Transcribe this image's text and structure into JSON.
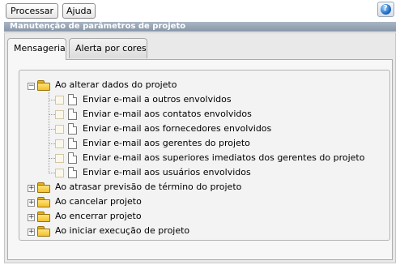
{
  "toolbar": {
    "processar_label": "Processar",
    "ajuda_label": "Ajuda",
    "help_icon": "help-globe-icon"
  },
  "title": "Manutenção de parâmetros de projeto",
  "tabs": [
    {
      "label": "Mensageria",
      "active": true
    },
    {
      "label": "Alerta por cores",
      "active": false
    }
  ],
  "tree": {
    "expanded_group": {
      "label": "Ao alterar dados do projeto",
      "items": [
        "Enviar e-mail a outros envolvidos",
        "Enviar e-mail aos contatos envolvidos",
        "Enviar e-mail aos fornecedores envolvidos",
        "Enviar e-mail aos gerentes do projeto",
        "Enviar e-mail aos superiores imediatos dos gerentes do projeto",
        "Enviar e-mail aos usuários envolvidos"
      ]
    },
    "collapsed_groups": [
      "Ao atrasar previsão de término do projeto",
      "Ao cancelar projeto",
      "Ao encerrar projeto",
      "Ao iniciar execução de projeto"
    ]
  },
  "colors": {
    "titlebar": "#8796a8",
    "folder": "#f2c12e",
    "checkbox_border": "#d2c6a3"
  }
}
